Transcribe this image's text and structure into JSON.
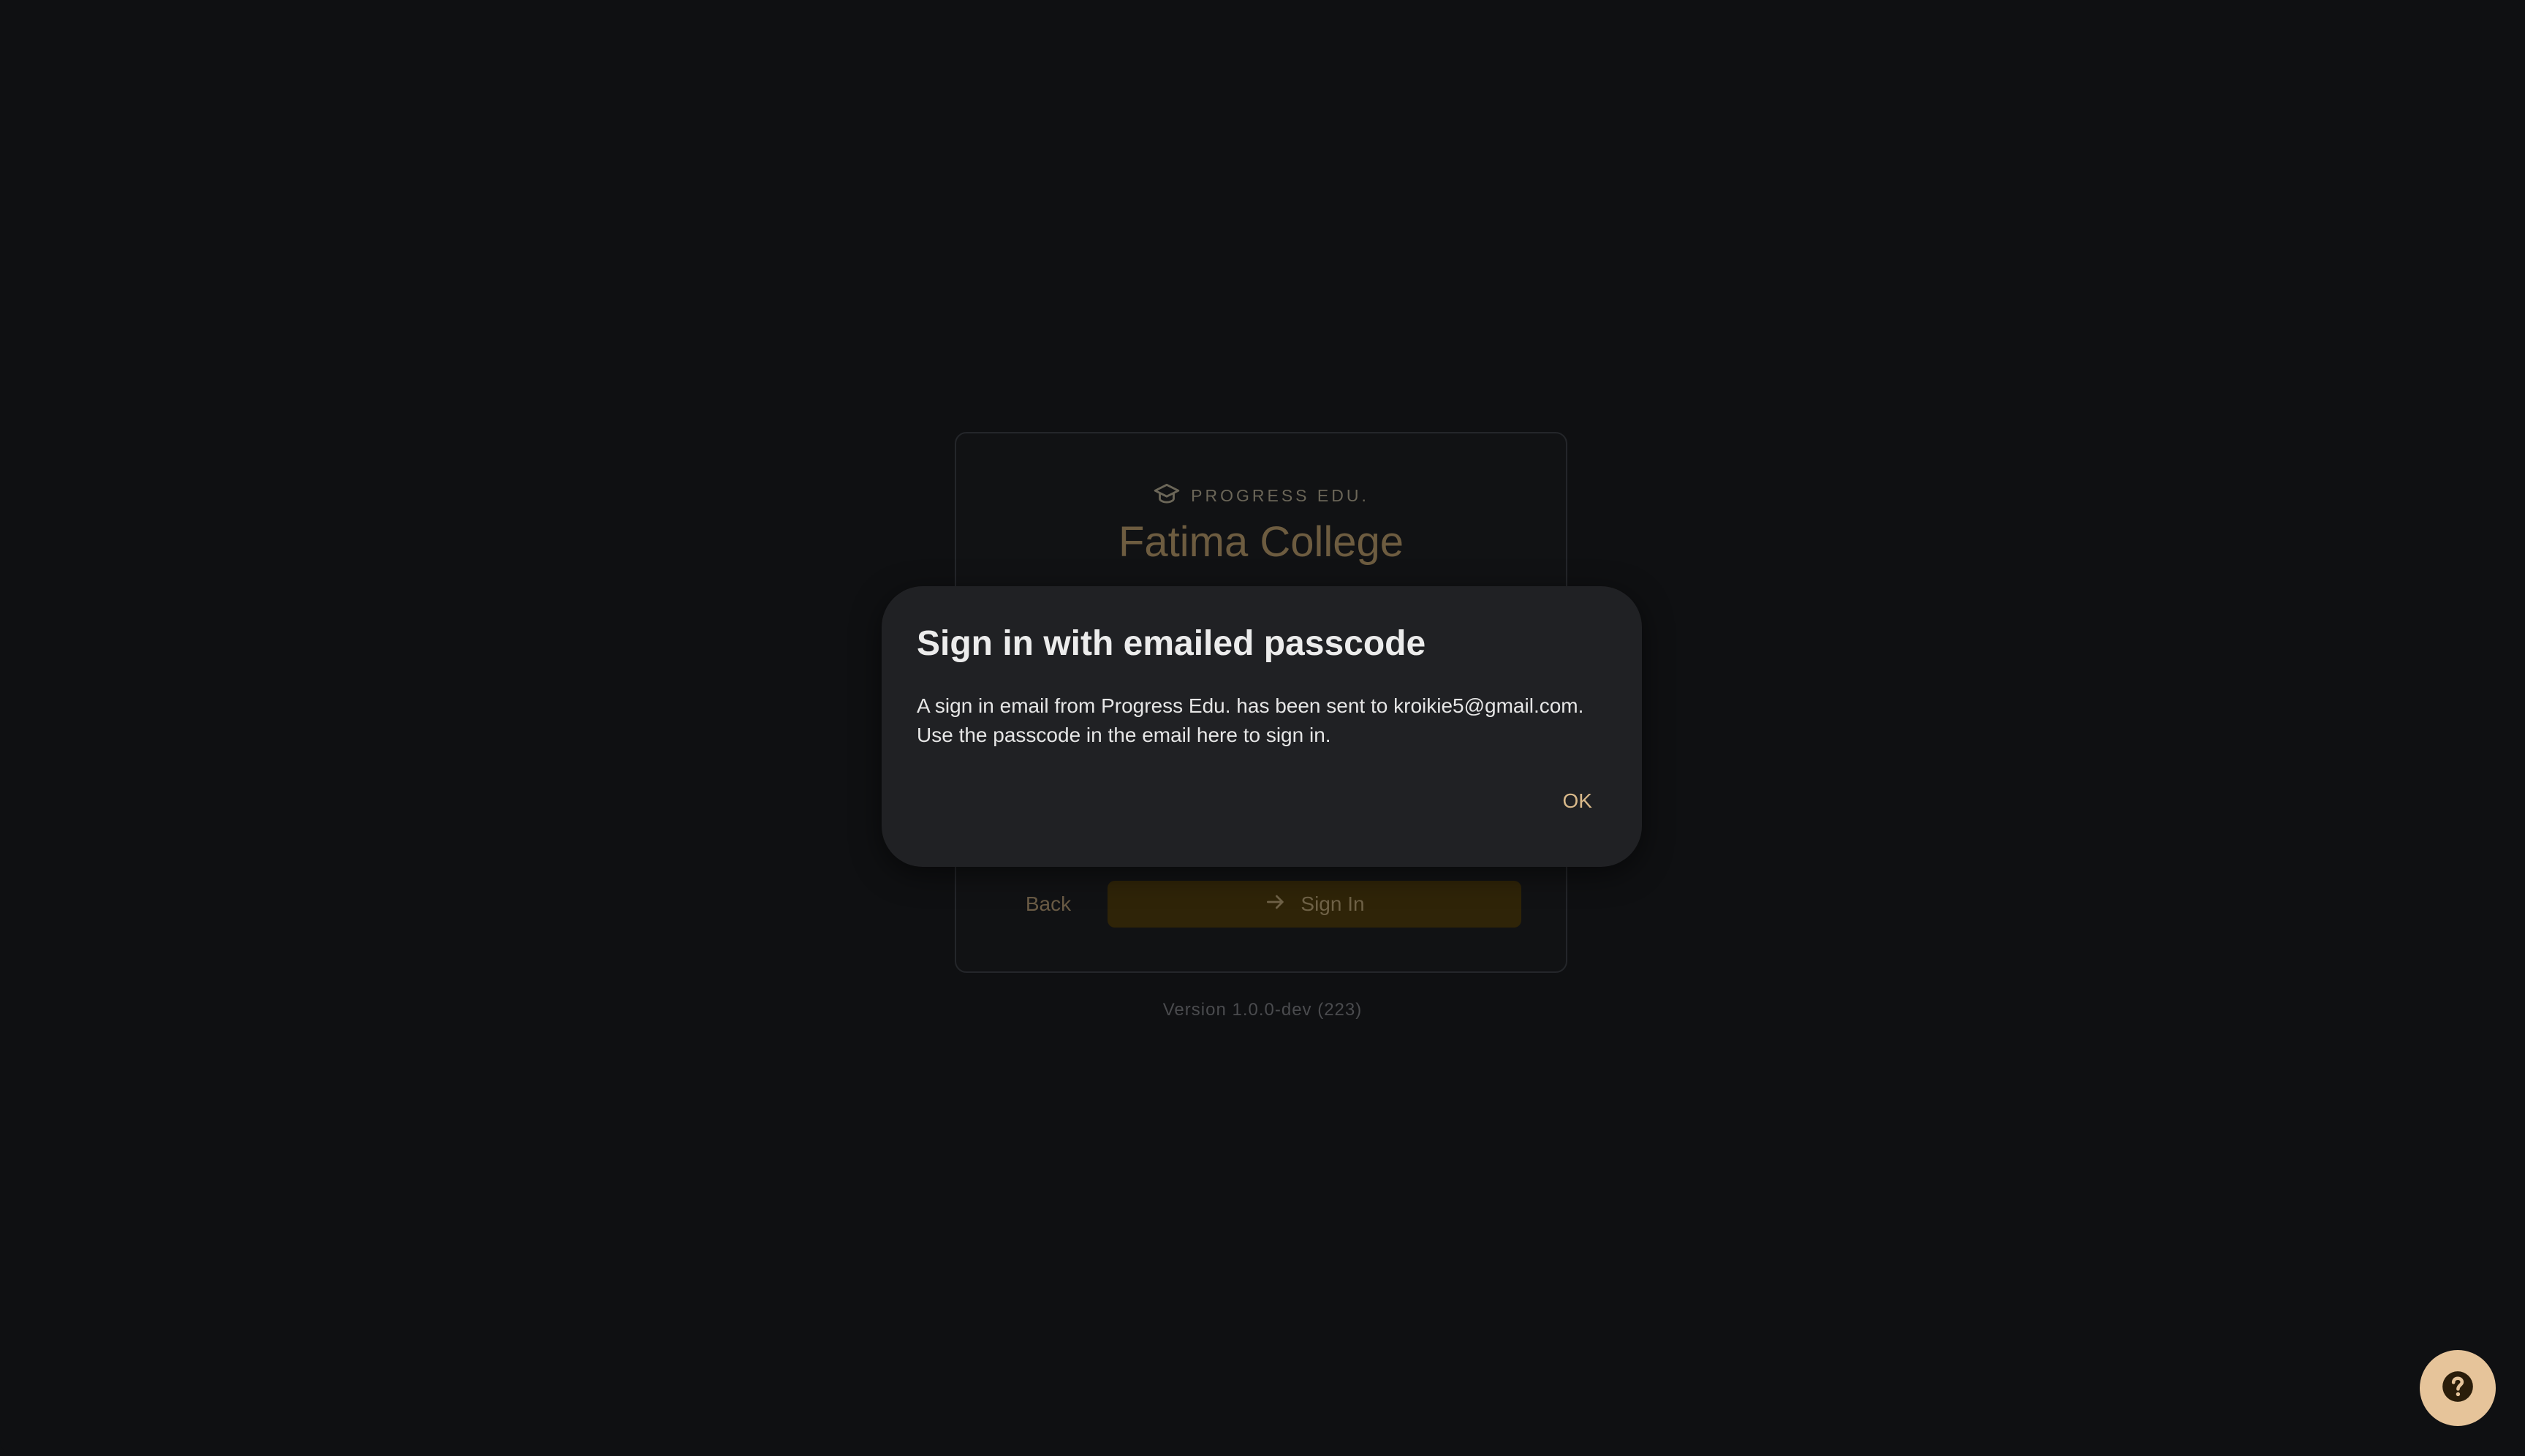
{
  "card": {
    "brand": "PROGRESS EDU.",
    "brand_icon": "graduation-cap-icon",
    "title": "Fatima College",
    "back_label": "Back",
    "signin_label": "Sign In",
    "signin_icon": "arrow-right-icon"
  },
  "version": "Version 1.0.0-dev (223)",
  "dialog": {
    "title": "Sign in with emailed passcode",
    "body_line1": "A sign in email from Progress Edu. has been sent to kroikie5@gmail.com.",
    "body_line2": "Use the passcode in the email here to sign in.",
    "ok_label": "OK"
  },
  "help": {
    "icon": "help-icon"
  },
  "colors": {
    "background": "#0f1012",
    "dialog": "#202124",
    "accent": "#e6c49a",
    "ok_text": "#d9b98a"
  }
}
